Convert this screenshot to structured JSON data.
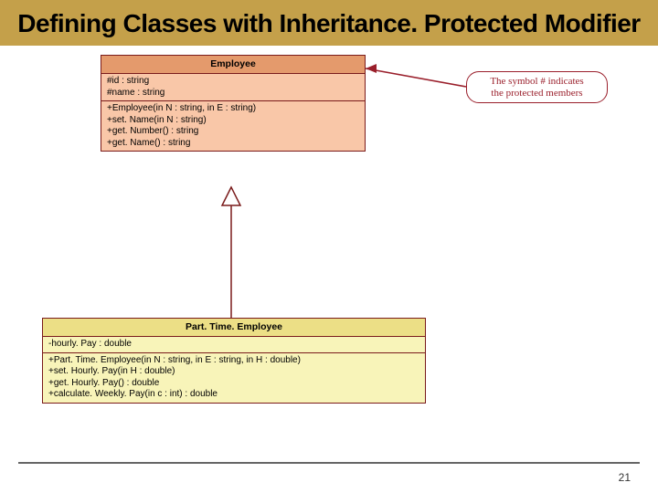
{
  "title": "Defining Classes with Inheritance. Protected Modifier",
  "page_number": "21",
  "note": {
    "line1": "The symbol # indicates",
    "line2": "the protected members"
  },
  "employee": {
    "name": "Employee",
    "attrs": [
      "#id : string",
      "#name : string"
    ],
    "ops": [
      "+Employee(in N : string, in E : string)",
      "+set. Name(in N : string)",
      "+get. Number() : string",
      "+get. Name() : string"
    ]
  },
  "parttime": {
    "name": "Part. Time. Employee",
    "attrs": [
      "-hourly. Pay : double"
    ],
    "ops": [
      "+Part. Time. Employee(in N : string, in E : string, in H : double)",
      "+set. Hourly. Pay(in H : double)",
      "+get. Hourly. Pay() : double",
      "+calculate. Weekly. Pay(in c : int) : double"
    ]
  }
}
